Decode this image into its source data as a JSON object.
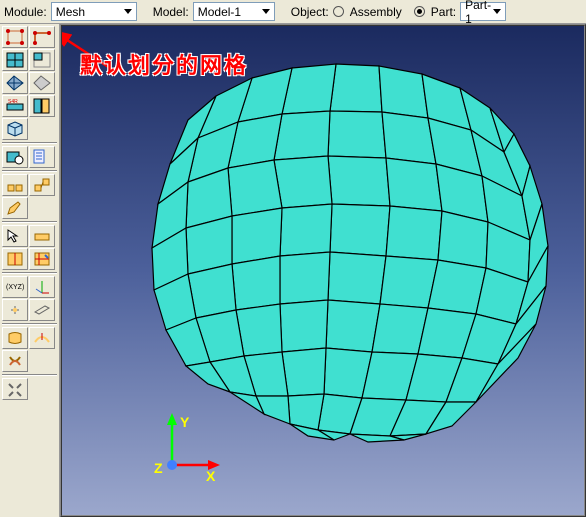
{
  "toolbar": {
    "module_label": "Module:",
    "module_value": "Mesh",
    "model_label": "Model:",
    "model_value": "Model-1",
    "object_label": "Object:",
    "assembly_label": "Assembly",
    "part_label": "Part:",
    "part_value": "Part-1"
  },
  "annotation": {
    "text": "默认划分的网格"
  },
  "triad": {
    "x": "X",
    "y": "Y",
    "z": "Z"
  },
  "toolbox_icon_colors": {
    "seed": "#c63",
    "mesh": "#4bc",
    "assign": "#696",
    "query": "#36c",
    "misc": "#888"
  }
}
